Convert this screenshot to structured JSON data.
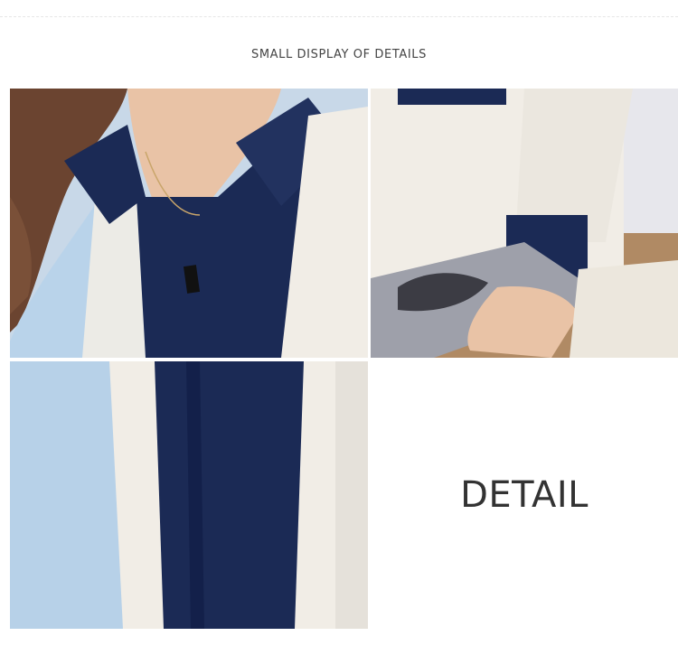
{
  "heading": "SMALL DISPLAY OF DETAILS",
  "detail_label": "DETAIL",
  "colors": {
    "navy": "#1b2a55",
    "light_blue": "#b9d3ea",
    "cream": "#f1ede6",
    "skin": "#e9c3a6",
    "hair": "#6b4430"
  }
}
